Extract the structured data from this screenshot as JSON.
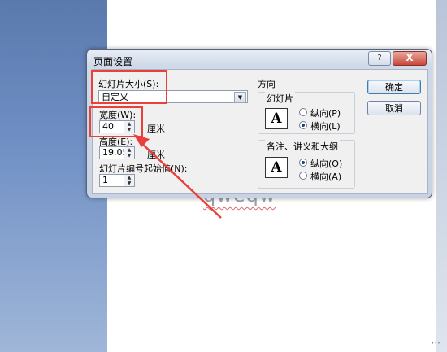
{
  "dialog": {
    "title": "页面设置",
    "help_label": "?",
    "close_label": "X",
    "slide_size": {
      "label": "幻灯片大小(S):",
      "value": "自定义"
    },
    "width": {
      "label": "宽度(W):",
      "value": "40",
      "unit": "厘米"
    },
    "height": {
      "label": "高度(E):",
      "value": "19.05",
      "unit": "厘米"
    },
    "start_number": {
      "label": "幻灯片编号起始值(N):",
      "value": "1"
    },
    "orientation": {
      "title": "方向",
      "slides": {
        "title": "幻灯片",
        "portrait": "纵向(P)",
        "landscape": "横向(L)",
        "selected": "landscape"
      },
      "notes": {
        "title": "备注、讲义和大纲",
        "portrait": "纵向(O)",
        "landscape": "横向(A)",
        "selected": "portrait"
      }
    },
    "buttons": {
      "ok": "确定",
      "cancel": "取消"
    }
  },
  "slide_text": "qweqw",
  "watermark": "···",
  "icons": {
    "help": "help-icon",
    "close": "close-icon",
    "dropdown": "chevron-down-icon",
    "page": "page-icon"
  },
  "colors": {
    "highlight": "#e8403a",
    "slide_bg": "#ffffff"
  }
}
